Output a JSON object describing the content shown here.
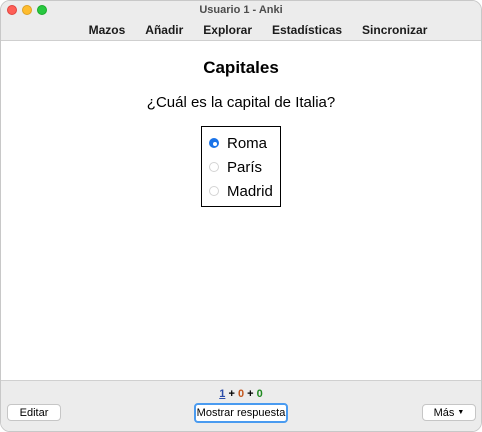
{
  "window": {
    "title": "Usuario 1 - Anki"
  },
  "toolbar": {
    "items": [
      "Mazos",
      "Añadir",
      "Explorar",
      "Estadísticas",
      "Sincronizar"
    ]
  },
  "card": {
    "deck_title": "Capitales",
    "question": "¿Cuál es la capital de Italia?",
    "options": [
      {
        "label": "Roma",
        "selected": true
      },
      {
        "label": "París",
        "selected": false
      },
      {
        "label": "Madrid",
        "selected": false
      }
    ]
  },
  "footer": {
    "counts": {
      "new": "1",
      "learning": "0",
      "review": "0",
      "separator": "+"
    },
    "edit_label": "Editar",
    "show_answer_label": "Mostrar respuesta",
    "more_label": "Más"
  },
  "colors": {
    "new_count": "#2a4ba8",
    "learning_count": "#c3561c",
    "review_count": "#1f8a1f",
    "radio_selected": "#1a73e8"
  }
}
